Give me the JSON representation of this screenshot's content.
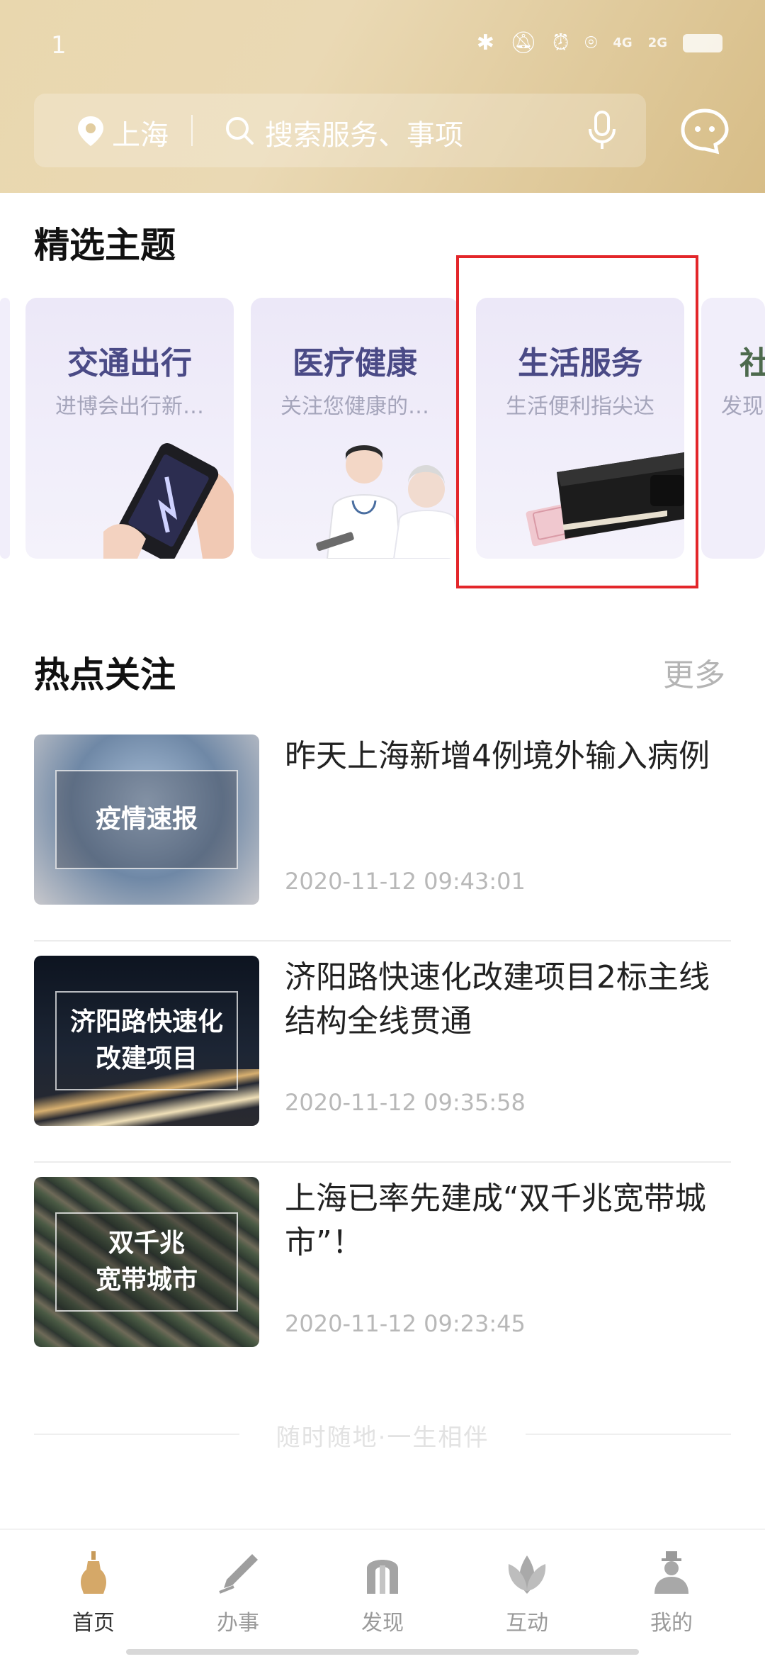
{
  "status_bar": {
    "time": "1",
    "network_1": "4G",
    "network_2": "2G"
  },
  "search": {
    "location": "上海",
    "placeholder": "搜索服务、事项"
  },
  "featured": {
    "title": "精选主题",
    "cards": [
      {
        "title": "交通出行",
        "subtitle": "进博会出行新…",
        "icon": "phone-in-hand-image"
      },
      {
        "title": "医疗健康",
        "subtitle": "关注您健康的…",
        "icon": "doctor-and-patient-image"
      },
      {
        "title": "生活服务",
        "subtitle": "生活便利指尖达",
        "icon": "wallet-image",
        "highlighted": true
      },
      {
        "title": "社",
        "subtitle": "发现"
      }
    ]
  },
  "hot": {
    "title": "热点关注",
    "more": "更多",
    "items": [
      {
        "thumb_label": "疫情速报",
        "title": "昨天上海新增4例境外输入病例",
        "time": "2020-11-12 09:43:01"
      },
      {
        "thumb_label": "济阳路快速化\n改建项目",
        "title": "济阳路快速化改建项目2标主线结构全线贯通",
        "time": "2020-11-12 09:35:58"
      },
      {
        "thumb_label": "双千兆\n宽带城市",
        "title": "上海已率先建成“双千兆宽带城市”！",
        "time": "2020-11-12 09:23:45"
      }
    ]
  },
  "footer": {
    "slogan": "随时随地·一生相伴"
  },
  "nav": {
    "items": [
      {
        "label": "首页",
        "icon": "home-icon",
        "active": true
      },
      {
        "label": "办事",
        "icon": "pen-icon"
      },
      {
        "label": "发现",
        "icon": "arch-icon"
      },
      {
        "label": "互动",
        "icon": "flower-icon"
      },
      {
        "label": "我的",
        "icon": "person-icon"
      }
    ]
  },
  "colors": {
    "header_gold": "#e3cf9f",
    "highlight_red": "#e3262a",
    "card_title": "#4a4a86"
  }
}
